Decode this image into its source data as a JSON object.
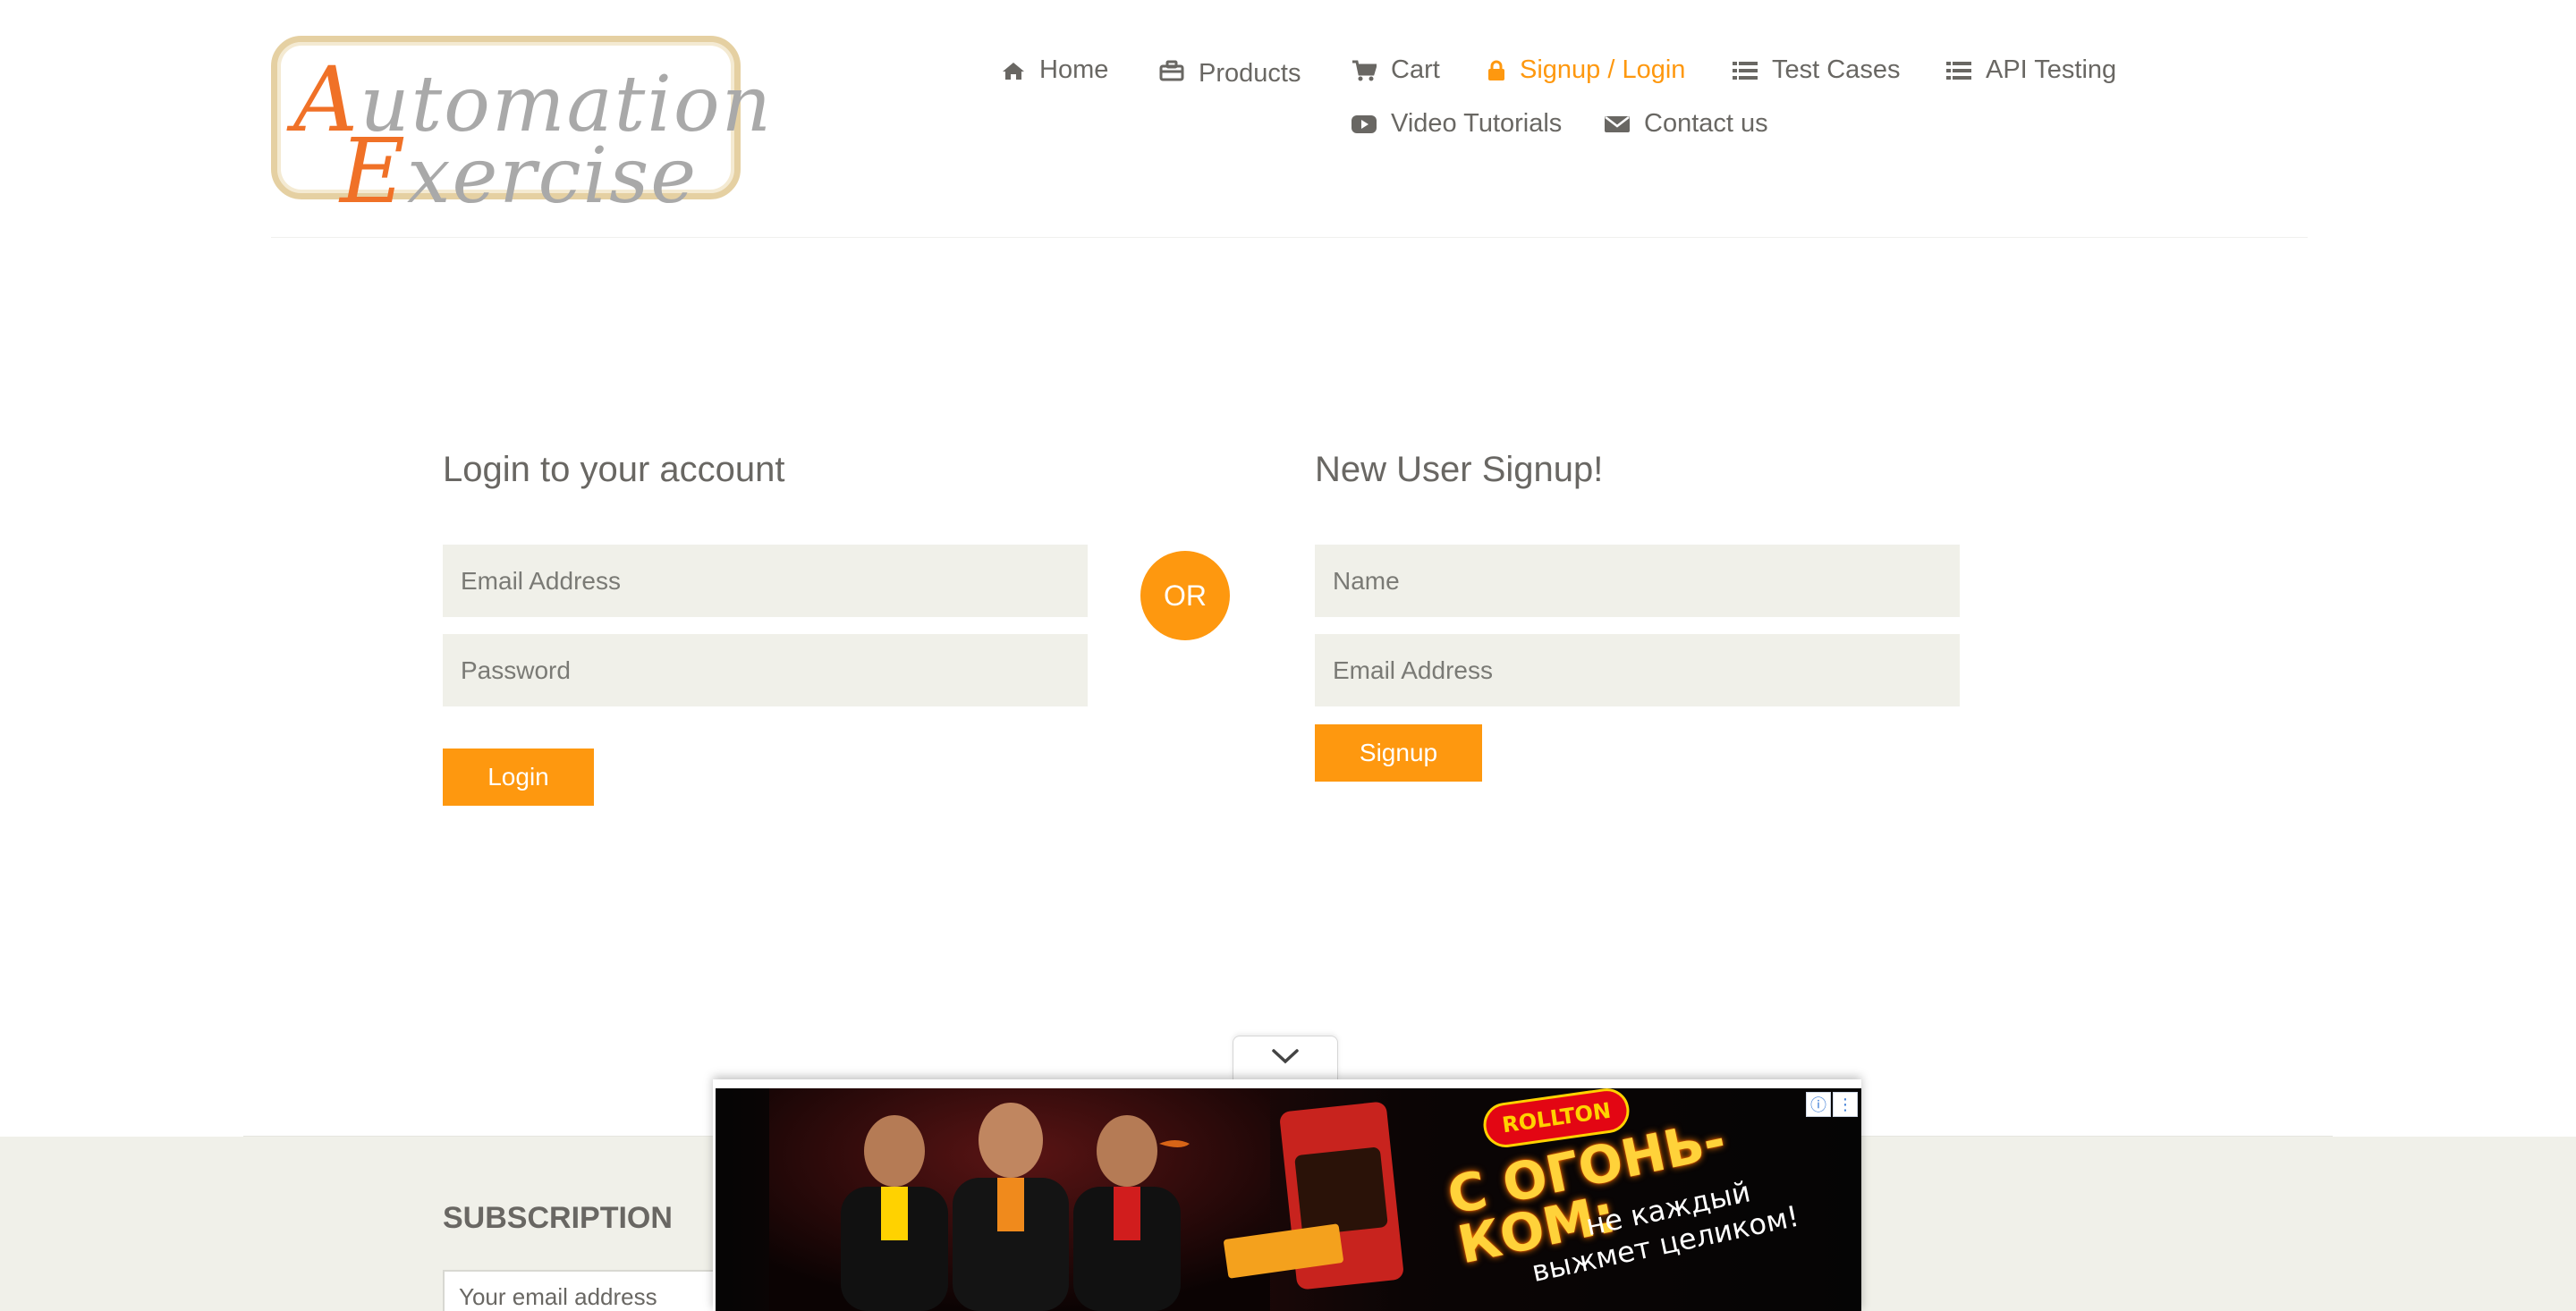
{
  "header": {
    "logo": {
      "line1": "Automation",
      "line2": "Exercise"
    },
    "nav": [
      {
        "label": "Home",
        "icon": "home-icon",
        "active": false
      },
      {
        "label": "Products",
        "icon": "briefcase-icon",
        "active": false
      },
      {
        "label": "Cart",
        "icon": "cart-icon",
        "active": false
      },
      {
        "label": "Signup / Login",
        "icon": "lock-icon",
        "active": true
      },
      {
        "label": "Test Cases",
        "icon": "list-icon",
        "active": false
      },
      {
        "label": "API Testing",
        "icon": "list-icon",
        "active": false
      },
      {
        "label": "Video Tutorials",
        "icon": "youtube-play-icon",
        "active": false
      },
      {
        "label": "Contact us",
        "icon": "envelope-icon",
        "active": false
      }
    ]
  },
  "login": {
    "title": "Login to your account",
    "email_placeholder": "Email Address",
    "password_placeholder": "Password",
    "button": "Login"
  },
  "or_label": "OR",
  "signup": {
    "title": "New User Signup!",
    "name_placeholder": "Name",
    "email_placeholder": "Email Address",
    "button": "Signup"
  },
  "footer": {
    "subscription_title": "SUBSCRIPTION",
    "email_placeholder": "Your email address"
  },
  "ad": {
    "brand": "ROLLTON",
    "headline_line1": "С ОГОНЬ-",
    "headline_line2": "КОМ:",
    "tagline_line1": "не каждый",
    "tagline_line2": "выжмет целиком!"
  },
  "colors": {
    "accent": "#fe980f",
    "text": "#696763",
    "field_bg": "#f0f0e9",
    "footer_bg": "#f0f0e9",
    "logo_orange": "#f07127"
  }
}
